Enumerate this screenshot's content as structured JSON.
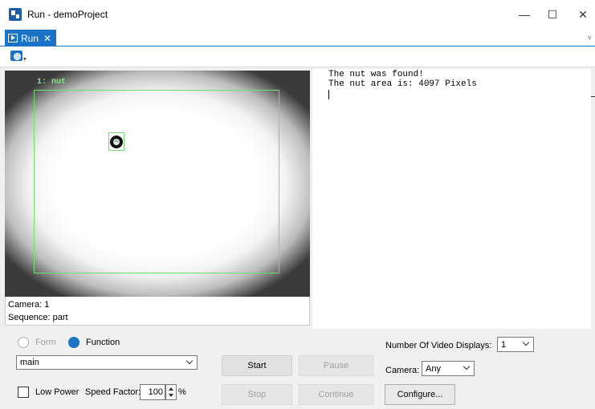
{
  "window": {
    "title": "Run - demoProject",
    "minimize_glyph": "—",
    "maximize_glyph": "☐",
    "close_glyph": "✕"
  },
  "tabs": [
    {
      "label": "Run",
      "active": true,
      "close_glyph": "✕"
    }
  ],
  "tab_overflow_glyph": "˅",
  "toolbar": {
    "camera_icon": "camera-icon",
    "dropdown_glyph": "▾"
  },
  "video": {
    "roi_label": "1: nut",
    "camera_label": "Camera: 1",
    "sequence_label": "Sequence: part"
  },
  "output": {
    "lines": [
      "The nut was found!",
      "The nut area is: 4097 Pixels"
    ]
  },
  "controls": {
    "mode": {
      "form_label": "Form",
      "function_label": "Function",
      "selected": "Function"
    },
    "function_select": {
      "value": "main"
    },
    "buttons": {
      "start": "Start",
      "pause": "Pause",
      "stop": "Stop",
      "continue": "Continue",
      "configure": "Configure..."
    },
    "low_power": {
      "label": "Low Power",
      "checked": false
    },
    "speed_factor": {
      "label": "Speed Factor:",
      "value": "100",
      "unit": "%"
    },
    "video_displays": {
      "label": "Number Of Video Displays:",
      "value": "1"
    },
    "camera": {
      "label": "Camera:",
      "value": "Any"
    }
  },
  "colors": {
    "accent": "#1a73c7",
    "roi_outline": "#6fdc6f",
    "disabled_text": "#a0a0a0"
  }
}
